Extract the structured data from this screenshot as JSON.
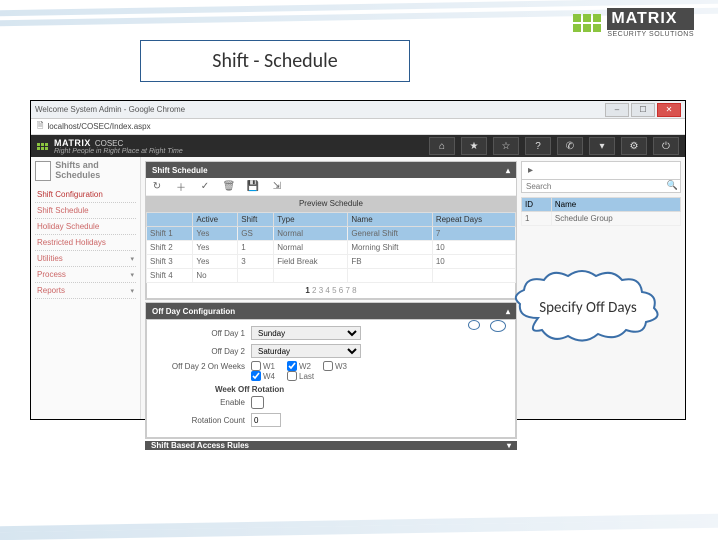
{
  "slide_title": "Shift - Schedule",
  "logo": {
    "brand": "MATRIX",
    "tag": "SECURITY SOLUTIONS"
  },
  "window": {
    "title": "Welcome System Admin - Google Chrome",
    "url": "localhost/COSEC/Index.aspx"
  },
  "app": {
    "brand": "MATRIX",
    "product": "COSEC",
    "tagline": "Right People in Right Place at Right Time"
  },
  "sidebar": {
    "head": "Shifts and Schedules",
    "items": [
      {
        "label": "Shift Configuration"
      },
      {
        "label": "Shift Schedule"
      },
      {
        "label": "Holiday Schedule"
      },
      {
        "label": "Restricted Holidays"
      },
      {
        "label": "Utilities"
      },
      {
        "label": "Process"
      },
      {
        "label": "Reports"
      }
    ]
  },
  "shift_schedule": {
    "header": "Shift Schedule",
    "preview_btn": "Preview Schedule",
    "columns": [
      "",
      "Active",
      "Shift",
      "Type",
      "Name",
      "Repeat Days"
    ],
    "rows": [
      {
        "id": "Shift 1",
        "active": "Yes",
        "shift": "GS",
        "type": "Normal",
        "name": "General Shift",
        "repeat": "7"
      },
      {
        "id": "Shift 2",
        "active": "Yes",
        "shift": "1",
        "type": "Normal",
        "name": "Morning Shift",
        "repeat": "10"
      },
      {
        "id": "Shift 3",
        "active": "Yes",
        "shift": "3",
        "type": "Field Break",
        "name": "FB",
        "repeat": "10"
      },
      {
        "id": "Shift 4",
        "active": "No",
        "shift": "",
        "type": "",
        "name": "",
        "repeat": ""
      }
    ],
    "pagination": [
      "1",
      "2",
      "3",
      "4",
      "5",
      "6",
      "7",
      "8"
    ]
  },
  "offday": {
    "header": "Off Day Configuration",
    "day1_label": "Off Day 1",
    "day1_value": "Sunday",
    "day2_label": "Off Day 2",
    "day2_value": "Saturday",
    "weeks_label": "Off Day 2 On Weeks",
    "weeks": [
      "W1",
      "W2",
      "W3",
      "W4",
      "Last"
    ],
    "weeks_checked": [
      "W2",
      "W4"
    ],
    "rotation_head": "Week Off Rotation",
    "enable_label": "Enable",
    "rotation_count_label": "Rotation Count",
    "rotation_count_value": "0"
  },
  "section3": {
    "header": "Shift Based Access Rules"
  },
  "rightpanel": {
    "search_placeholder": "Search",
    "columns": [
      "ID",
      "Name"
    ],
    "rows": [
      {
        "id": "1",
        "name": "Schedule Group"
      }
    ]
  },
  "callout": "Specify Off Days"
}
